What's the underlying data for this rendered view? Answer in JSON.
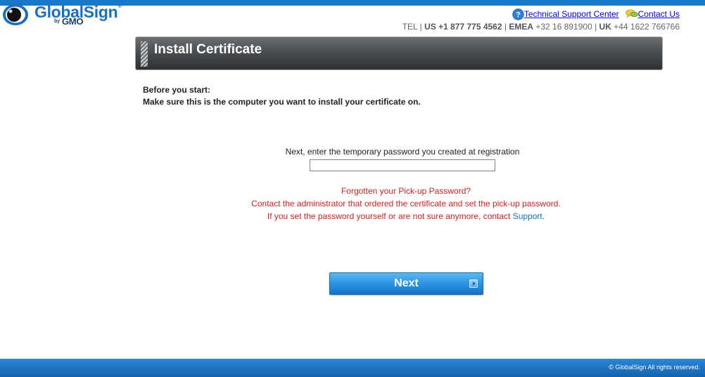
{
  "brand": {
    "name": "GlobalSign",
    "by": "by",
    "parent": "GMO",
    "reg": "®"
  },
  "header": {
    "support_link": "Technical Support Center",
    "contact_link": "Contact Us",
    "tel": {
      "label": "TEL",
      "us_code": "US",
      "us_number": "+1 877 775 4562",
      "emea_code": "EMEA",
      "emea_number": "+32 16 891900",
      "uk_code": "UK",
      "uk_number": "+44 1622 766766"
    }
  },
  "page": {
    "title": "Install Certificate",
    "intro_line1": "Before you start:",
    "intro_line2": "Make sure this is the computer you want to install your certificate on."
  },
  "form": {
    "password_prompt": "Next, enter the temporary password you created at registration",
    "password_value": "",
    "forgot_title": "Forgotten your Pick-up Password?",
    "forgot_line1": "Contact the administrator that ordered the certificate and set the pick-up password.",
    "forgot_line2": "If you set the password yourself or are not sure anymore, contact",
    "support_link": "Support",
    "trailing_period": ".",
    "next_button": "Next"
  },
  "footer": {
    "copyright": "© GlobalSign All rights reserved."
  },
  "icons": {
    "help": "help-question-icon",
    "contact": "chat-bubble-icon",
    "next_arrow": "arrow-right-icon",
    "logo": "globalsign-eye-logo"
  },
  "colors": {
    "accent": "#1877c9",
    "banner": "#4b4e51",
    "warning_text": "#cc2222",
    "link": "#0000ee"
  }
}
